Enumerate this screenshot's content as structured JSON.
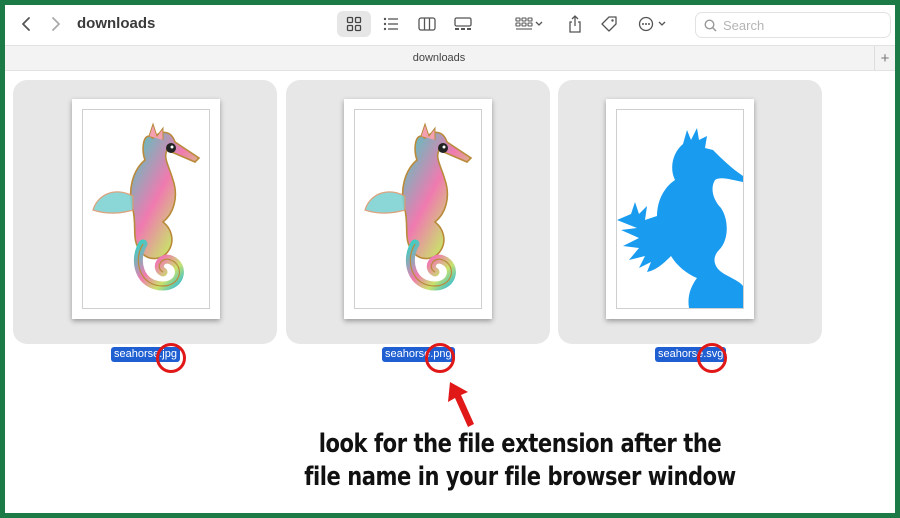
{
  "window": {
    "title": "downloads",
    "path_label": "downloads"
  },
  "toolbar": {
    "search_placeholder": "Search",
    "icons": [
      "chevron-left-icon",
      "chevron-right-icon",
      "grid-view-icon",
      "list-view-icon",
      "column-view-icon",
      "gallery-view-icon",
      "group-icon",
      "share-icon",
      "tag-icon",
      "more-icon",
      "search-icon"
    ]
  },
  "files": [
    {
      "name": "seahorse.jpg",
      "kind": "color-seahorse"
    },
    {
      "name": "seahorse.png",
      "kind": "color-seahorse"
    },
    {
      "name": "seahorse.svg",
      "kind": "blue-silhouette"
    }
  ],
  "annotation": {
    "line1": "look for the file extension after the",
    "line2": "file name in your file browser window"
  },
  "colors": {
    "frame": "#1b7a45",
    "highlight": "#1f5fd1",
    "circle": "#e01818",
    "silhouette": "#199bf0"
  }
}
